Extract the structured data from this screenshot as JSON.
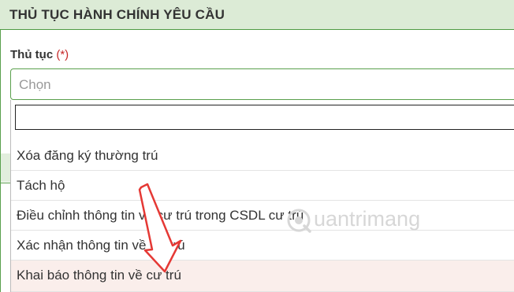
{
  "header": {
    "title": "THỦ TỤC HÀNH CHÍNH YÊU CẦU"
  },
  "field": {
    "label": "Thủ tục",
    "required_mark": "(*)",
    "placeholder": "Chọn"
  },
  "dropdown": {
    "search_value": "",
    "options": [
      {
        "label": "Xóa đăng ký thường trú",
        "highlighted": false
      },
      {
        "label": "Tách hộ",
        "highlighted": false
      },
      {
        "label": "Điều chỉnh thông tin về cư trú trong CSDL cư trú",
        "highlighted": false
      },
      {
        "label": "Xác nhận thông tin về cư trú",
        "highlighted": false
      },
      {
        "label": "Khai báo thông tin về cư trú",
        "highlighted": true
      }
    ]
  },
  "watermark": {
    "text": "uantrimang"
  },
  "colors": {
    "accent_green": "#5aa04d",
    "header_bg": "#dcebd6",
    "required_red": "#c62828",
    "arrow_red": "#e53935",
    "highlight_bg": "#faeeeb"
  },
  "icons": {
    "annotation": "red-arrow-icon",
    "logo": "quantrimang-logo-icon"
  }
}
